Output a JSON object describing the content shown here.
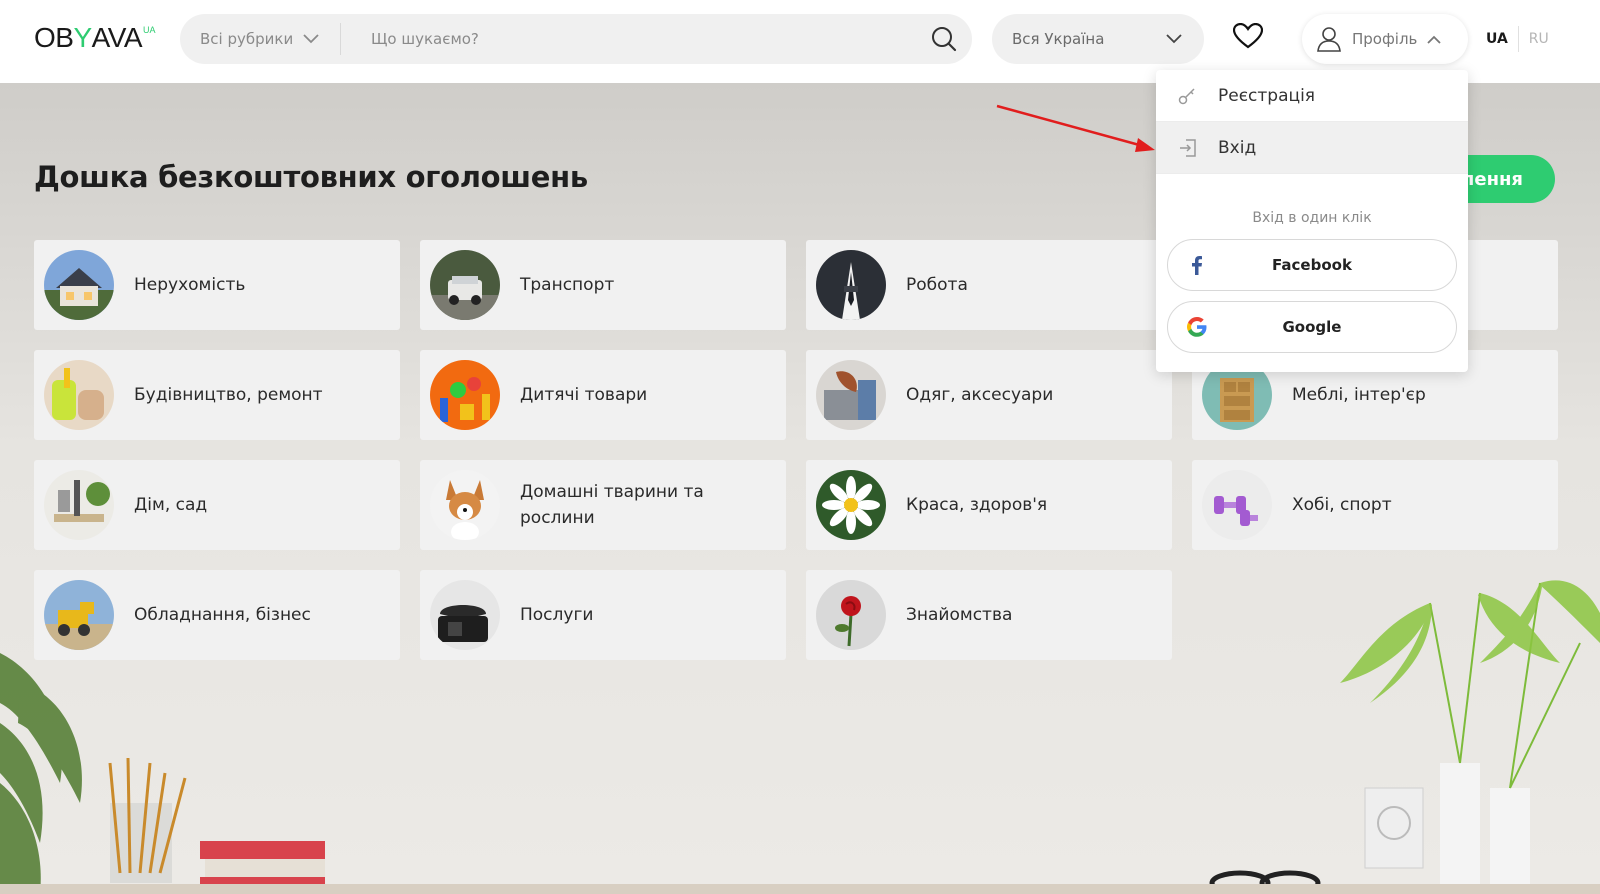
{
  "header": {
    "logo": {
      "part1": "OB",
      "part2": "Y",
      "part3": "AVA",
      "sup": "UA"
    },
    "rubric_label": "Всі рубрики",
    "search_placeholder": "Що шукаємо?",
    "region_label": "Вся Україна",
    "profile_label": "Профіль",
    "lang_active": "UA",
    "lang_other": "RU"
  },
  "main": {
    "title": "Дошка безкоштовних оголошень",
    "post_button_visible_text": "лення"
  },
  "categories": [
    {
      "label": "Нерухомість",
      "icon": "house-photo"
    },
    {
      "label": "Транспорт",
      "icon": "jeep-photo"
    },
    {
      "label": "Робота",
      "icon": "suit-photo"
    },
    {
      "label": "",
      "icon": "hidden-photo"
    },
    {
      "label": "Будівництво, ремонт",
      "icon": "tools-photo"
    },
    {
      "label": "Дитячі товари",
      "icon": "toys-photo"
    },
    {
      "label": "Одяг, аксесуари",
      "icon": "clothes-photo"
    },
    {
      "label": "Меблі, інтер'єр",
      "icon": "cabinet-photo"
    },
    {
      "label": "Дім, сад",
      "icon": "garden-tools-photo"
    },
    {
      "label": "Домашні тварини та рослини",
      "icon": "dog-photo"
    },
    {
      "label": "Краса, здоров'я",
      "icon": "flower-photo"
    },
    {
      "label": "Хобі, спорт",
      "icon": "dumbbells-photo"
    },
    {
      "label": "Обладнання, бізнес",
      "icon": "machinery-photo"
    },
    {
      "label": "Послуги",
      "icon": "phone-photo"
    },
    {
      "label": "Знайомства",
      "icon": "rose-photo"
    }
  ],
  "profile_dropdown": {
    "register_label": "Реєстрація",
    "login_label": "Вхід",
    "one_click_label": "Вхід в один клік",
    "facebook_label": "Facebook",
    "google_label": "Google"
  },
  "colors": {
    "brand_green": "#2ecc71",
    "annotation_arrow": "#e11d1d",
    "facebook_blue": "#3b5998"
  }
}
